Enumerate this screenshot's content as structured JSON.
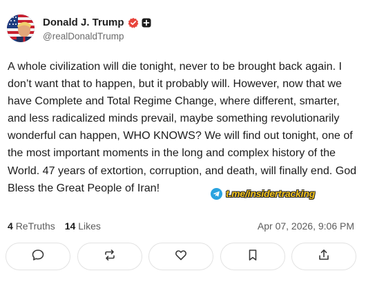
{
  "author": {
    "display_name": "Donald J. Trump",
    "handle": "@realDonaldTrump",
    "avatar_icon": "flag-portrait-avatar",
    "verified_icon": "verified-check-icon",
    "extra_badge_icon": "plus-badge-icon"
  },
  "post": {
    "text": "A whole civilization will die tonight, never to be brought back again. I don’t want that to happen, but it probably will. However, now that we have Complete and Total Regime Change, where different, smarter, and less radicalized minds prevail, maybe something revolutionarily wonderful can happen, WHO KNOWS? We will find out tonight, one of the most important moments in the long and complex history of the World. 47 years of extortion, corruption, and death, will finally end. God Bless the Great People of Iran!"
  },
  "watermark": {
    "icon": "telegram-icon",
    "text": "t.me/insidertracking"
  },
  "stats": {
    "retruths_count": "4",
    "retruths_label": "ReTruths",
    "likes_count": "14",
    "likes_label": "Likes",
    "timestamp": "Apr 07, 2026, 9:06 PM"
  },
  "actions": [
    {
      "name": "reply",
      "icon": "speech-bubble-icon"
    },
    {
      "name": "retruth",
      "icon": "repost-arrows-icon"
    },
    {
      "name": "like",
      "icon": "heart-icon"
    },
    {
      "name": "bookmark",
      "icon": "bookmark-icon"
    },
    {
      "name": "share",
      "icon": "share-upload-icon"
    }
  ],
  "colors": {
    "verified_badge": "#e8453c",
    "watermark_text": "#f2c21b",
    "telegram": "#2aa3df",
    "muted_text": "#5b5b5b"
  }
}
